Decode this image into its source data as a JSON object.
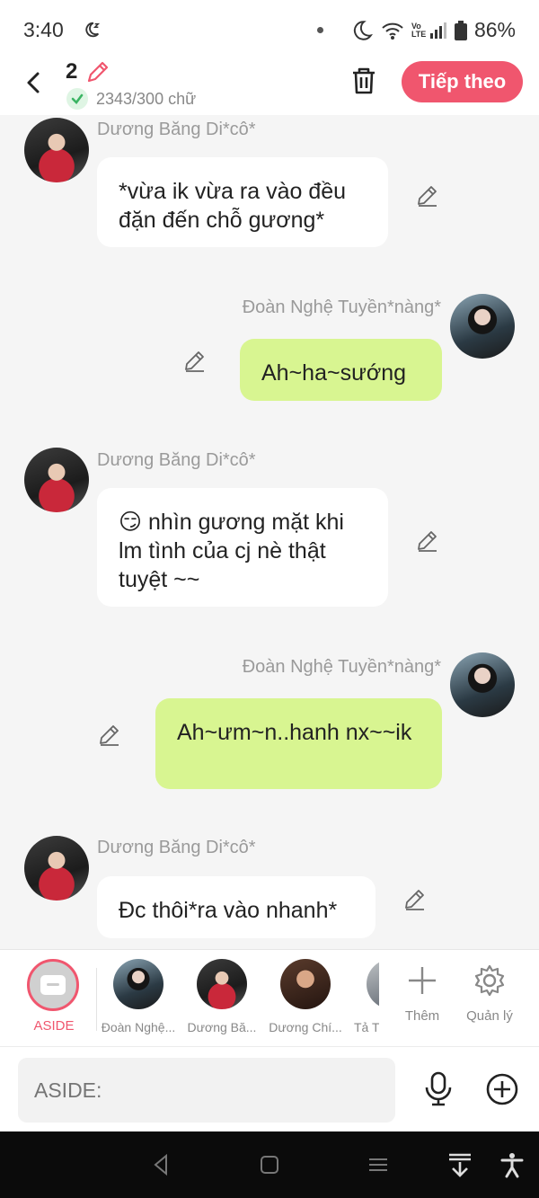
{
  "status_bar": {
    "time": "3:40",
    "battery": "86%",
    "network": "Vo LTE"
  },
  "header": {
    "count": "2",
    "word_count": "2343/300 chữ",
    "next_label": "Tiếp theo"
  },
  "messages": [
    {
      "sender": "Dương Băng Di*cô*",
      "side": "left",
      "text": "*vừa ik vừa ra vào đều đặn đến chỗ gương*"
    },
    {
      "sender": "Đoàn Nghệ Tuyền*nàng*",
      "side": "right",
      "text": "Ah~ha~sướng"
    },
    {
      "sender": "Dương Băng Di*cô*",
      "side": "left",
      "text": "😏 nhìn gương mặt khi lm tình của cj nè thật tuyệt ~~"
    },
    {
      "sender": "Đoàn Nghệ Tuyền*nàng*",
      "side": "right",
      "text": "Ah~ưm~n..hanh nx~~ik"
    },
    {
      "sender": "Dương Băng Di*cô*",
      "side": "left",
      "text": "Đc thôi*ra vào nhanh*"
    }
  ],
  "character_bar": {
    "aside_label": "ASIDE",
    "characters": [
      "Đoàn Nghệ...",
      "Dương Bă...",
      "Dương Chí...",
      "Tả T"
    ],
    "more_label": "Thêm",
    "manage_label": "Quản lý"
  },
  "input": {
    "placeholder": "ASIDE:"
  },
  "colors": {
    "accent": "#f0566e",
    "outgoing_bubble": "#d8f591",
    "incoming_bubble": "#ffffff",
    "background": "#f5f5f5"
  },
  "icons": [
    "moon-z-icon",
    "moon-icon",
    "wifi-icon",
    "signal-icon",
    "battery-icon",
    "back-icon",
    "pencil-icon",
    "check-icon",
    "trash-icon",
    "edit-icon",
    "plus-icon",
    "gear-icon",
    "microphone-icon",
    "add-circle-icon",
    "nav-back-icon",
    "nav-home-icon",
    "nav-menu-icon",
    "nav-collapse-icon",
    "accessibility-icon"
  ]
}
